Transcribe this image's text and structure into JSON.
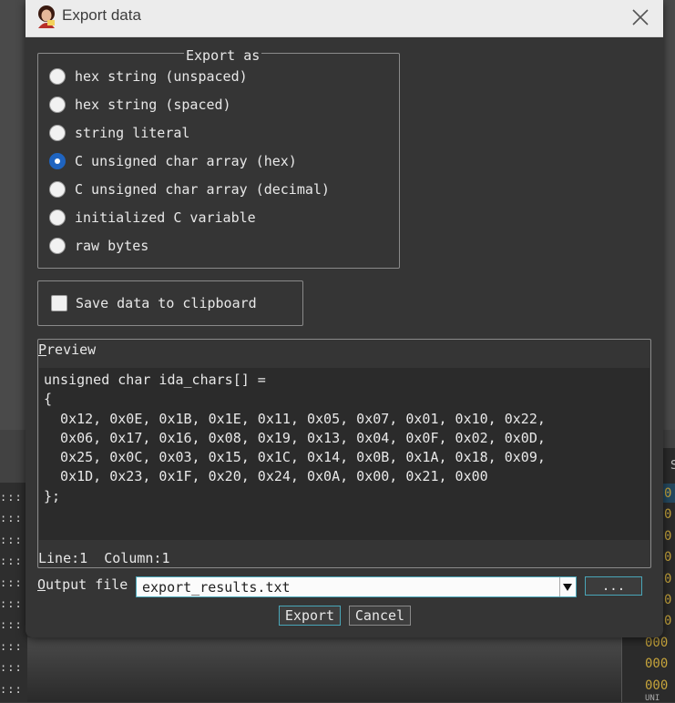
{
  "dialog": {
    "title": "Export data"
  },
  "export_as": {
    "legend": "Export as",
    "options": [
      {
        "label": "hex string (unspaced)",
        "selected": false
      },
      {
        "label": "hex string (spaced)",
        "selected": false
      },
      {
        "label": "string literal",
        "selected": false
      },
      {
        "label": "C unsigned char array (hex)",
        "selected": true
      },
      {
        "label": "C unsigned char array (decimal)",
        "selected": false
      },
      {
        "label": "initialized C variable",
        "selected": false
      },
      {
        "label": "raw bytes",
        "selected": false
      }
    ]
  },
  "clipboard": {
    "label": "Save data to clipboard",
    "checked": false
  },
  "preview": {
    "label_first": "P",
    "label_rest": "review",
    "code_lines": [
      "unsigned char ida_chars[] =",
      "{",
      "  0x12, 0x0E, 0x1B, 0x1E, 0x11, 0x05, 0x07, 0x01, 0x10, 0x22,",
      "  0x06, 0x17, 0x16, 0x08, 0x19, 0x13, 0x04, 0x0F, 0x02, 0x0D,",
      "  0x25, 0x0C, 0x03, 0x15, 0x1C, 0x14, 0x0B, 0x1A, 0x18, 0x09,",
      "  0x1D, 0x23, 0x1F, 0x20, 0x24, 0x0A, 0x00, 0x21, 0x00",
      "};"
    ],
    "status": "Line:1  Column:1"
  },
  "output": {
    "label_first": "O",
    "label_rest": "utput file",
    "value": "export_results.txt",
    "browse_label": "..."
  },
  "buttons": {
    "export": "Export",
    "cancel": "Cancel"
  },
  "background": {
    "dot_rows": [
      ":::",
      ":::",
      ":::",
      ":::",
      ":::",
      ":::",
      ":::",
      ":::",
      ":::",
      ":::"
    ],
    "right_header": "S",
    "right_rows": [
      "0",
      "0",
      "0",
      "0",
      "0",
      "0",
      "0",
      "000",
      "000",
      "000"
    ],
    "right_bottom": "UNI"
  },
  "colors": {
    "dialog_bg": "#353535",
    "accent": "#1f64c0",
    "focus_border": "#49a6b8",
    "code_bg": "#2b2b2b"
  },
  "icons": {
    "app": "app-logo-icon",
    "close": "close-icon",
    "combo": "chevron-down-icon"
  }
}
